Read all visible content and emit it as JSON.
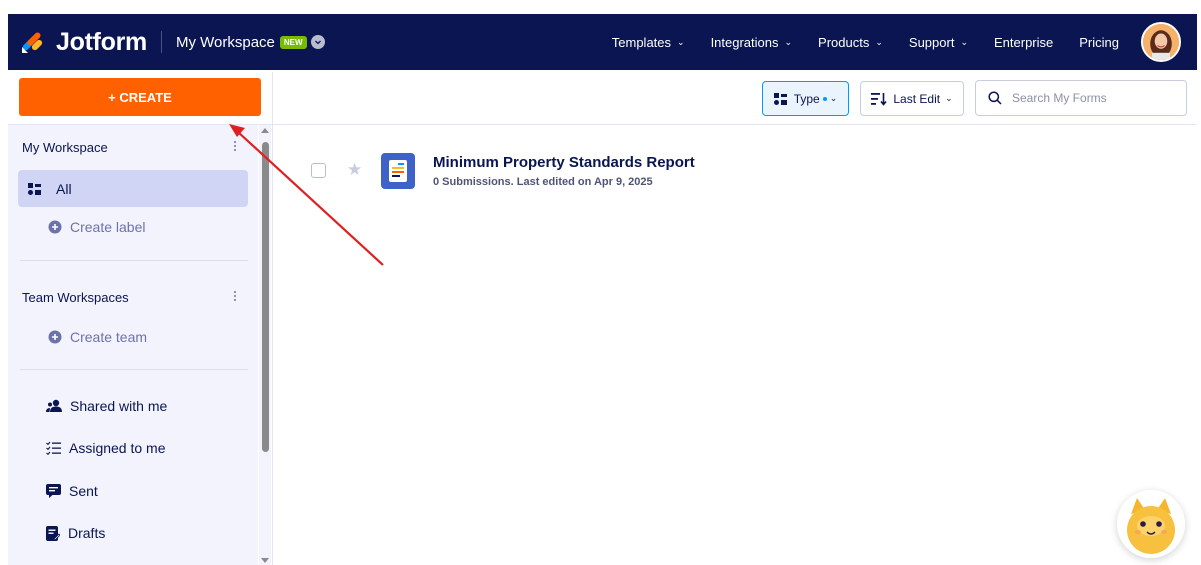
{
  "nav": {
    "brand": "Jotform",
    "workspace": "My Workspace",
    "new_badge": "NEW",
    "links": [
      "Templates",
      "Integrations",
      "Products",
      "Support",
      "Enterprise",
      "Pricing"
    ]
  },
  "toolbar": {
    "create_label": "+ CREATE",
    "type_label": "Type",
    "sort_label": "Last Edit",
    "search_placeholder": "Search My Forms"
  },
  "sidebar": {
    "my_workspace": "My Workspace",
    "all_label": "All",
    "create_label": "Create label",
    "team_workspaces": "Team Workspaces",
    "create_team": "Create team",
    "shared": "Shared with me",
    "assigned": "Assigned to me",
    "sent": "Sent",
    "drafts": "Drafts"
  },
  "forms": [
    {
      "title": "Minimum Property Standards Report",
      "meta": "0 Submissions. Last edited on Apr 9, 2025"
    }
  ],
  "colors": {
    "nav_bg": "#0a1551",
    "create_btn": "#ff6100",
    "annotation_arrow": "#e02020"
  }
}
